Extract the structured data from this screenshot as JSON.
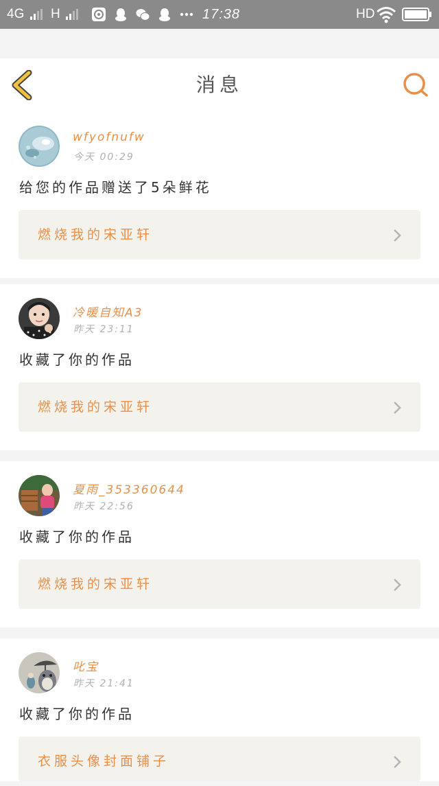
{
  "status_bar": {
    "network_1": "4G",
    "network_2": "H",
    "time": "17:38",
    "hd": "HD"
  },
  "header": {
    "title": "消息"
  },
  "colors": {
    "accent": "#e8904a",
    "back_arrow": "#f0c040",
    "status_bar_bg": "#8a8a8a",
    "card_box_bg": "#f3f2ec"
  },
  "icons": {
    "back": "back-arrow-icon",
    "search": "search-icon",
    "chevron": "chevron-right-icon"
  },
  "messages": [
    {
      "username": "wfyofnufw",
      "time": "今天  00:29",
      "text": "给您的作品赠送了5朵鲜花",
      "work_title": "燃烧我的宋亚轩"
    },
    {
      "username": "冷暖自知A3",
      "time": "昨天  23:11",
      "text": "收藏了你的作品",
      "work_title": "燃烧我的宋亚轩"
    },
    {
      "username": "夏雨_353360644",
      "time": "昨天  22:56",
      "text": "收藏了你的作品",
      "work_title": "燃烧我的宋亚轩"
    },
    {
      "username": "叱宝",
      "time": "昨天  21:41",
      "text": "收藏了你的作品",
      "work_title": "衣服头像封面铺子"
    }
  ]
}
